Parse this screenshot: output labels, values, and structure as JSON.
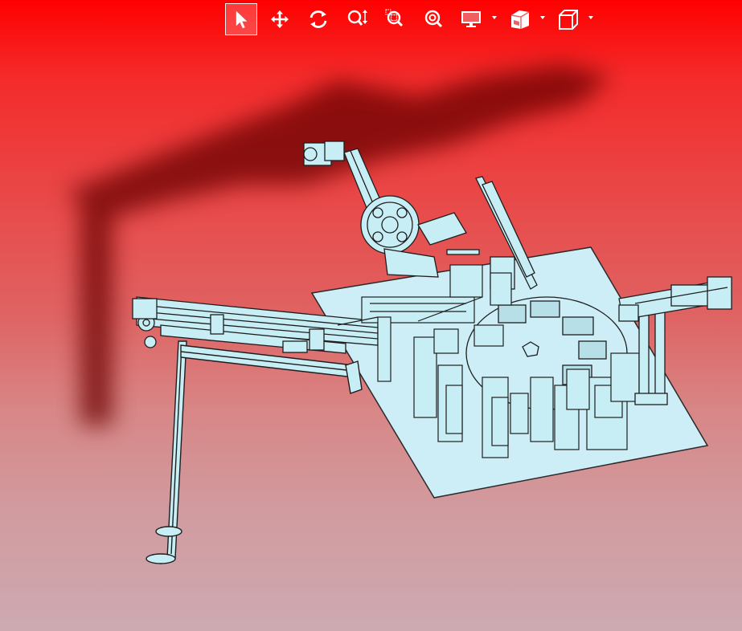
{
  "viewer": {
    "background_top": "#ff0000",
    "background_bottom": "#cdaab2",
    "model_color": "#c8eef5",
    "outline_color": "#1e1e1e",
    "shadow_color": "#5a0000"
  },
  "toolbar": {
    "tools": [
      {
        "id": "select",
        "icon": "pointer-arrow-icon",
        "active": true,
        "has_menu": false
      },
      {
        "id": "pan",
        "icon": "move-arrows-icon",
        "active": false,
        "has_menu": false
      },
      {
        "id": "rotate",
        "icon": "rotate-icon",
        "active": false,
        "has_menu": false
      },
      {
        "id": "zoom",
        "icon": "zoom-updown-icon",
        "active": false,
        "has_menu": false
      },
      {
        "id": "zoom-window",
        "icon": "zoom-window-icon",
        "active": false,
        "has_menu": false
      },
      {
        "id": "zoom-fit",
        "icon": "zoom-fit-icon",
        "active": false,
        "has_menu": false
      },
      {
        "id": "display",
        "icon": "monitor-icon",
        "active": false,
        "has_menu": true
      },
      {
        "id": "section",
        "icon": "section-cube-icon",
        "active": false,
        "has_menu": true
      },
      {
        "id": "view",
        "icon": "view-cube-icon",
        "active": false,
        "has_menu": true
      }
    ]
  }
}
